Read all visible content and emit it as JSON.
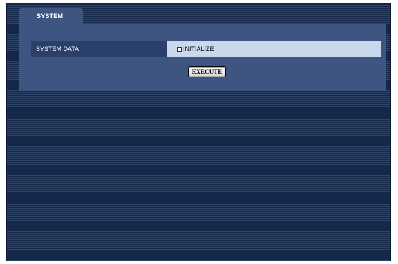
{
  "tab": {
    "label": "SYSTEM"
  },
  "system_data": {
    "label": "SYSTEM DATA",
    "initialize_label": "INITIALIZE",
    "initialize_checked": false
  },
  "execute": {
    "label": "EXECUTE"
  },
  "colors": {
    "panel": "#3d5580",
    "label_cell": "#2a4068",
    "value_cell": "#c9d8ea",
    "background": "#1c2e4e"
  }
}
